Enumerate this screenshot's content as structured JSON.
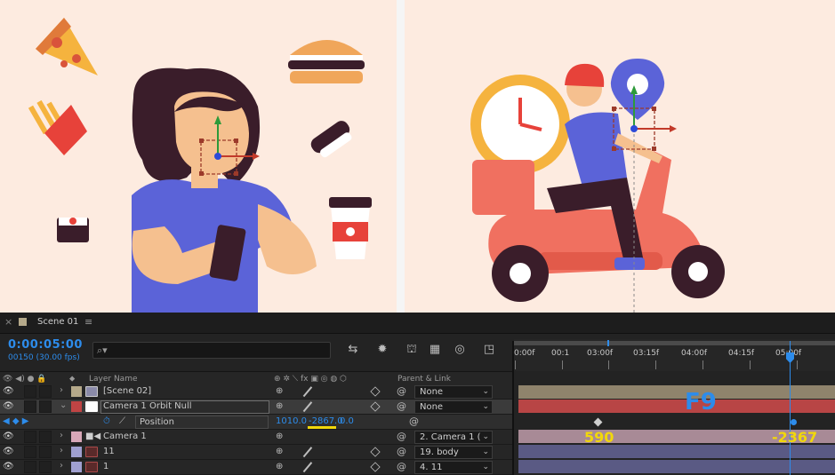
{
  "composition": {
    "tab_title": "Scene 01",
    "timecode": "0:00:05:00",
    "frame_info": "00150 (30.00 fps)"
  },
  "columns": {
    "layer_name": "Layer Name",
    "parent_link": "Parent & Link"
  },
  "layers": [
    {
      "name": "[Scene 02]",
      "parent": "None",
      "label_color": "#b5a98a"
    },
    {
      "name": "Camera 1 Orbit Null",
      "parent": "None",
      "label_color": "#c04444"
    },
    {
      "name": "Camera 1",
      "parent": "2. Camera 1 (",
      "label_color": "#d8a8b8"
    },
    {
      "name": "11",
      "parent": "19. body",
      "label_color": "#a0a0d0"
    },
    {
      "name": "1",
      "parent": "4. 11",
      "label_color": "#a0a0d0"
    }
  ],
  "position_property": {
    "label": "Position",
    "x": "1010.0",
    "y": "-2867.0",
    "z": "0.0"
  },
  "ruler": [
    "0:00f",
    "00:1",
    "03:00f",
    "03:15f",
    "04:00f",
    "04:15f",
    "05:00f"
  ],
  "annotations": {
    "hotkey": "F9",
    "value_start": "590",
    "value_end": "-2367"
  },
  "colors": {
    "accent_blue": "#2d8ceb",
    "annotation_yellow": "#f2d80a",
    "canvas_bg": "#fdebe0"
  }
}
